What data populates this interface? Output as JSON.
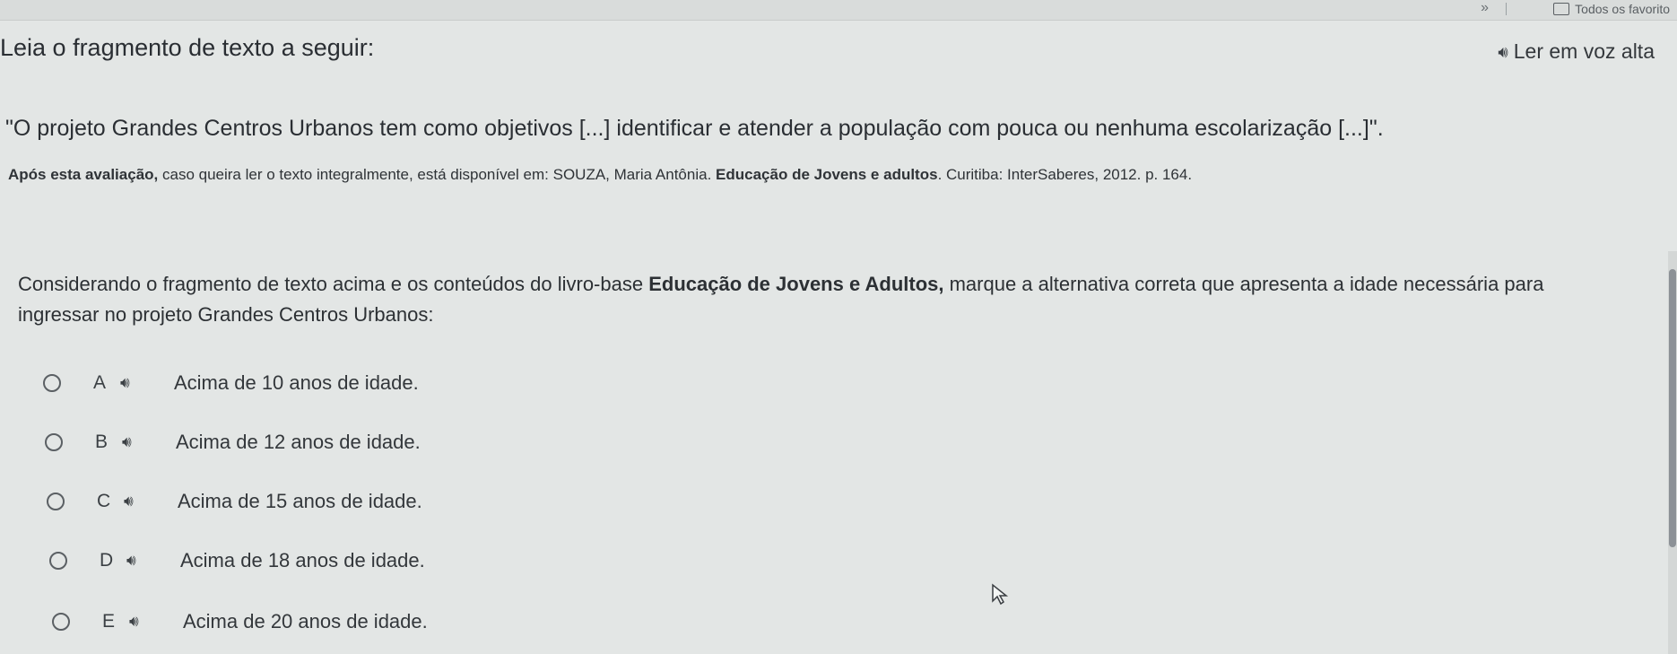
{
  "browser": {
    "favorites_label": "Todos os favorito",
    "overflow_glyph": "»"
  },
  "instruction": "Leia o fragmento de texto a seguir:",
  "read_aloud": {
    "label": "Ler em voz alta",
    "icon": "speaker-icon"
  },
  "quote": "\"O projeto Grandes Centros Urbanos tem como objetivos [...] identificar e atender a população com pouca ou nenhuma escolarização [...]\".",
  "source": {
    "prefix": "Após esta avaliação,",
    "text": " caso queira ler o texto integralmente, está disponível em: SOUZA, Maria Antônia. ",
    "book": "Educação de Jovens e adultos",
    "suffix": ". Curitiba: InterSaberes, 2012. p. 164."
  },
  "question": {
    "part1": "Considerando o fragmento de texto acima e os conteúdos do livro-base ",
    "book": "Educação de Jovens e Adultos,",
    "part2": " marque a alternativa correta que apresenta a idade necessária para ingressar no projeto Grandes Centros Urbanos:"
  },
  "options": [
    {
      "letter": "A",
      "text": "Acima de 10 anos de idade."
    },
    {
      "letter": "B",
      "text": "Acima de 12 anos de idade."
    },
    {
      "letter": "C",
      "text": "Acima de 15 anos de idade."
    },
    {
      "letter": "D",
      "text": "Acima de 18 anos de idade."
    },
    {
      "letter": "E",
      "text": "Acima de 20 anos de idade."
    }
  ],
  "colors": {
    "background": "#e3e6e5",
    "text": "#2b2f33"
  }
}
